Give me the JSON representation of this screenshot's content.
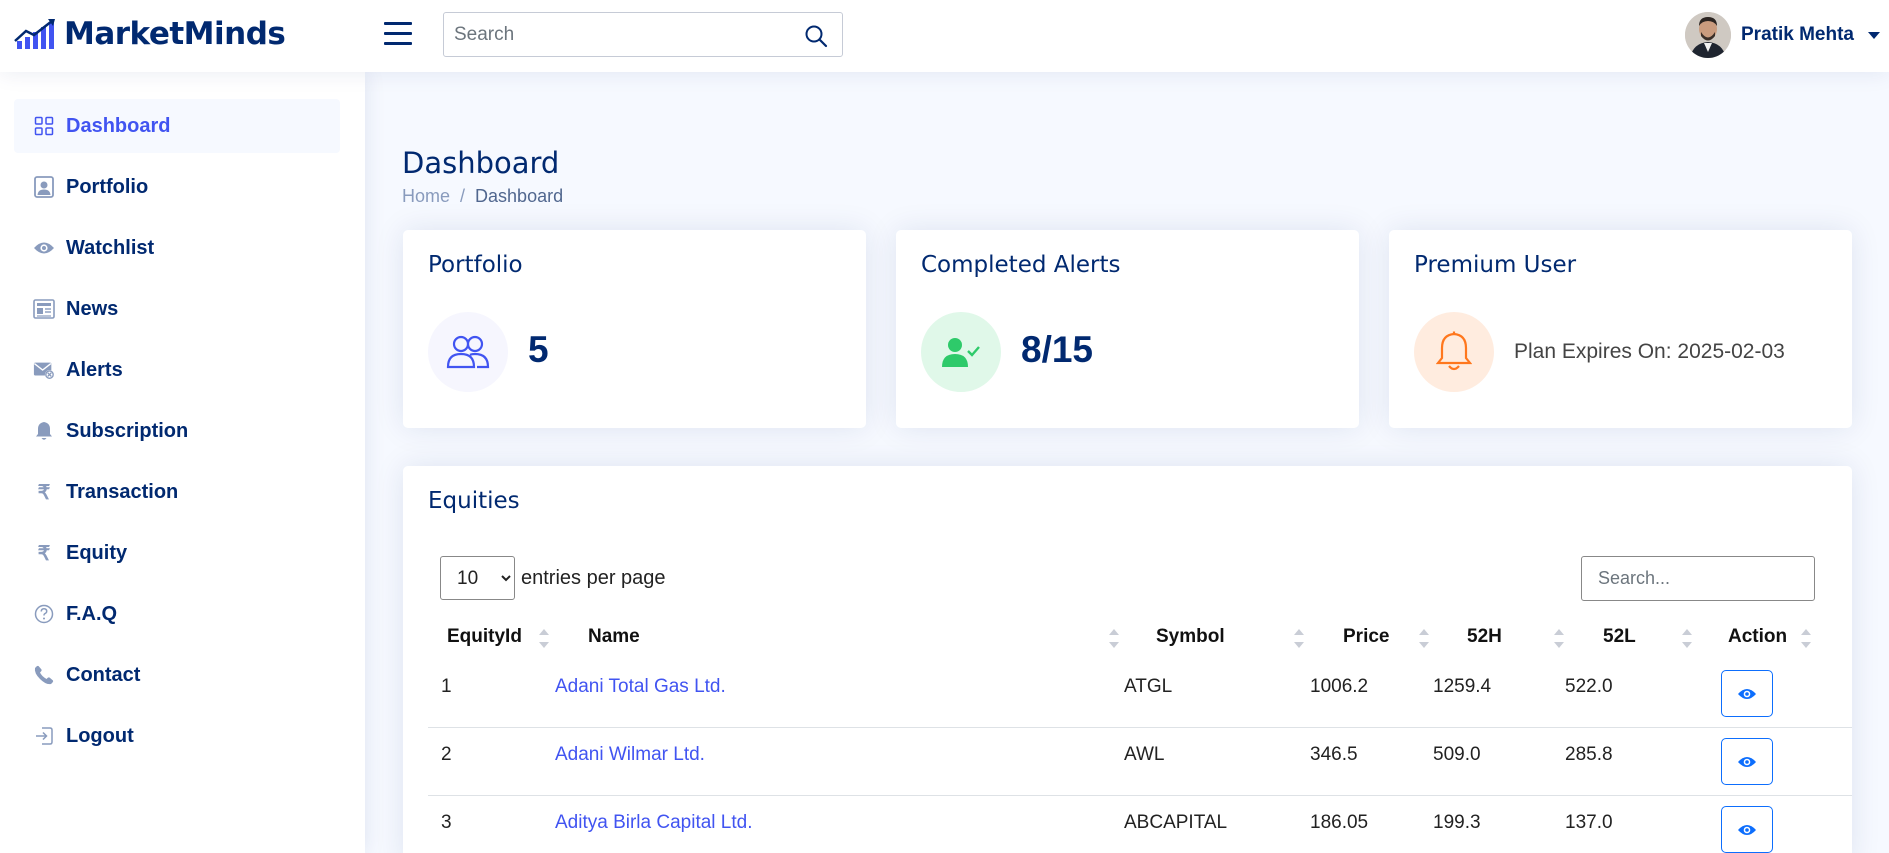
{
  "app": {
    "brand": "MarketMinds",
    "search_placeholder": "Search",
    "user_name": "Pratik Mehta"
  },
  "sidebar": {
    "items": [
      {
        "label": "Dashboard",
        "icon": "grid-icon",
        "active": true
      },
      {
        "label": "Portfolio",
        "icon": "person-badge-icon"
      },
      {
        "label": "Watchlist",
        "icon": "eye-icon"
      },
      {
        "label": "News",
        "icon": "newspaper-icon"
      },
      {
        "label": "Alerts",
        "icon": "envelope-x-icon"
      },
      {
        "label": "Subscription",
        "icon": "bell-icon"
      },
      {
        "label": "Transaction",
        "icon": "rupee-icon"
      },
      {
        "label": "Equity",
        "icon": "rupee-icon"
      },
      {
        "label": "F.A.Q",
        "icon": "question-circle-icon"
      },
      {
        "label": "Contact",
        "icon": "telephone-icon"
      },
      {
        "label": "Logout",
        "icon": "box-arrow-in-right-icon"
      }
    ]
  },
  "page": {
    "title": "Dashboard",
    "breadcrumb": {
      "home": "Home",
      "separator": "/",
      "current": "Dashboard"
    }
  },
  "cards": {
    "portfolio": {
      "title": "Portfolio",
      "value": "5",
      "icon": "people-icon"
    },
    "alerts": {
      "title": "Completed Alerts",
      "value": "8/15",
      "icon": "person-check-icon"
    },
    "premium": {
      "title": "Premium User",
      "text": "Plan Expires On: 2025-02-03",
      "icon": "bell-icon"
    }
  },
  "equities": {
    "title": "Equities",
    "per_page_value": "10",
    "per_page_label": "entries per page",
    "search_placeholder": "Search...",
    "columns": [
      "EquityId",
      "Name",
      "Symbol",
      "Price",
      "52H",
      "52L",
      "Action"
    ],
    "rows": [
      {
        "id": "1",
        "name": "Adani Total Gas Ltd.",
        "symbol": "ATGL",
        "price": "1006.2",
        "high": "1259.4",
        "low": "522.0"
      },
      {
        "id": "2",
        "name": "Adani Wilmar Ltd.",
        "symbol": "AWL",
        "price": "346.5",
        "high": "509.0",
        "low": "285.8"
      },
      {
        "id": "3",
        "name": "Aditya Birla Capital Ltd.",
        "symbol": "ABCAPITAL",
        "price": "186.05",
        "high": "199.3",
        "low": "137.0"
      }
    ]
  },
  "colors": {
    "primary": "#012970",
    "accent": "#4154f1",
    "success": "#2eca6a",
    "warning": "#ff771d",
    "button_blue": "#0d6efd"
  }
}
